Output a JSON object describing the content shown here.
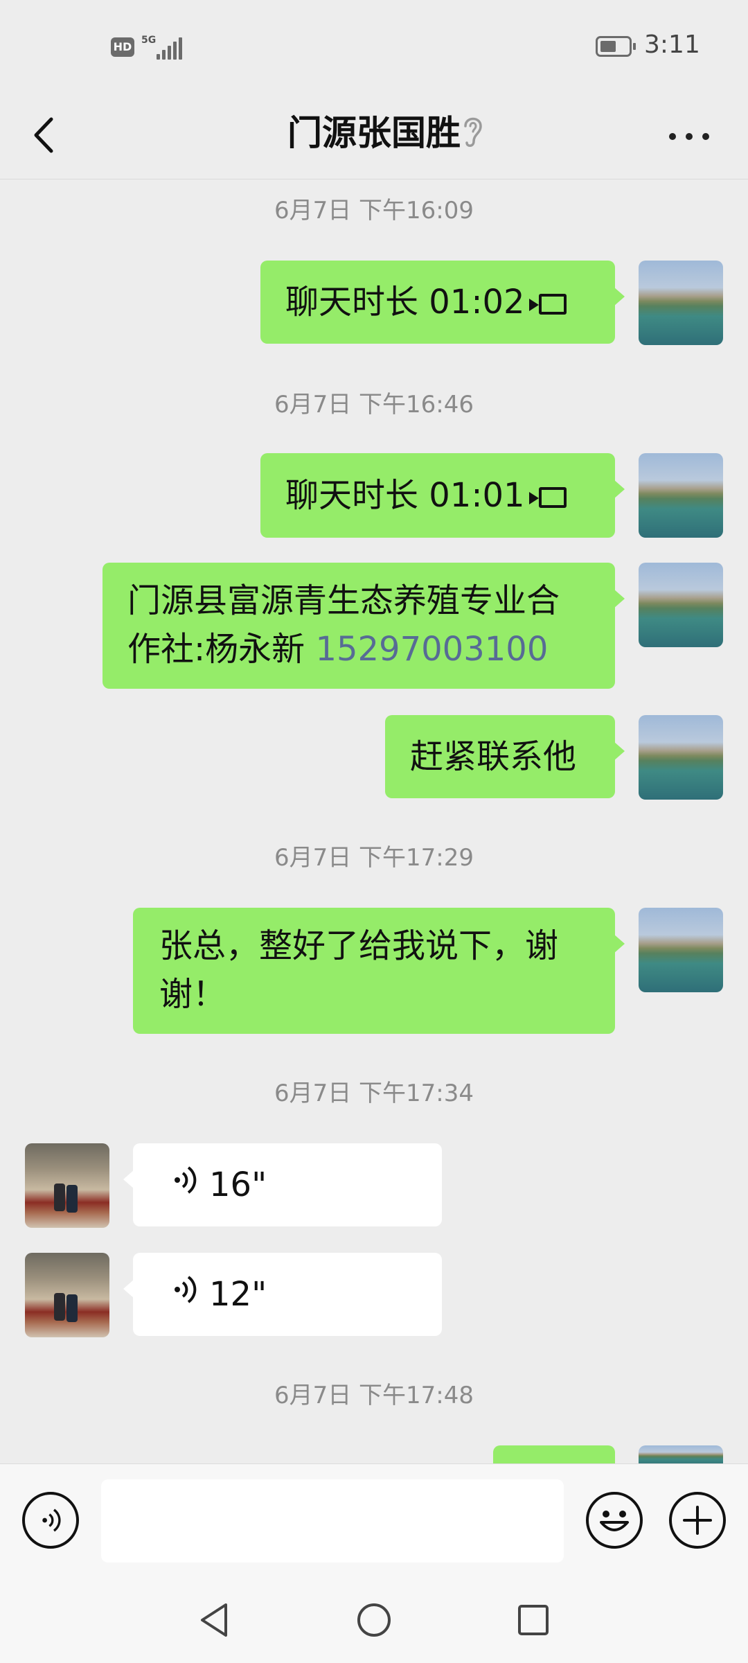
{
  "status_bar": {
    "hd": "HD",
    "network": "5G",
    "time": "3:11"
  },
  "header": {
    "title": "门源张国胜"
  },
  "messages": {
    "ts1": "6月7日 下午16:09",
    "call1": "聊天时长 01:02",
    "ts2": "6月7日 下午16:46",
    "call2": "聊天时长 01:01",
    "msg_contact_text": "门源县富源青生态养殖专业合作社:杨永新 ",
    "msg_contact_phone": "15297003100",
    "msg_urge": "赶紧联系他",
    "ts3": "6月7日 下午17:29",
    "msg_thanks": "张总，整好了给我说下，谢谢！",
    "ts4": "6月7日 下午17:34",
    "voice1": "16\"",
    "voice2": "12\"",
    "ts5": "6月7日 下午17:48"
  },
  "icons": {
    "back": "back-arrow-icon",
    "ear": "earpiece-icon",
    "more": "more-icon",
    "video_call": "video-call-icon",
    "voice": "voice-wave-icon",
    "voice_input": "voice-input-icon",
    "emoji": "emoji-icon",
    "add": "add-icon",
    "nav_back": "nav-back-icon",
    "nav_home": "nav-home-icon",
    "nav_recent": "nav-recent-icon"
  },
  "colors": {
    "background": "#EDEDED",
    "bubble_out": "#95EC69",
    "bubble_in": "#FFFFFF",
    "link": "#576B95",
    "timestamp": "#8A8A8A"
  }
}
